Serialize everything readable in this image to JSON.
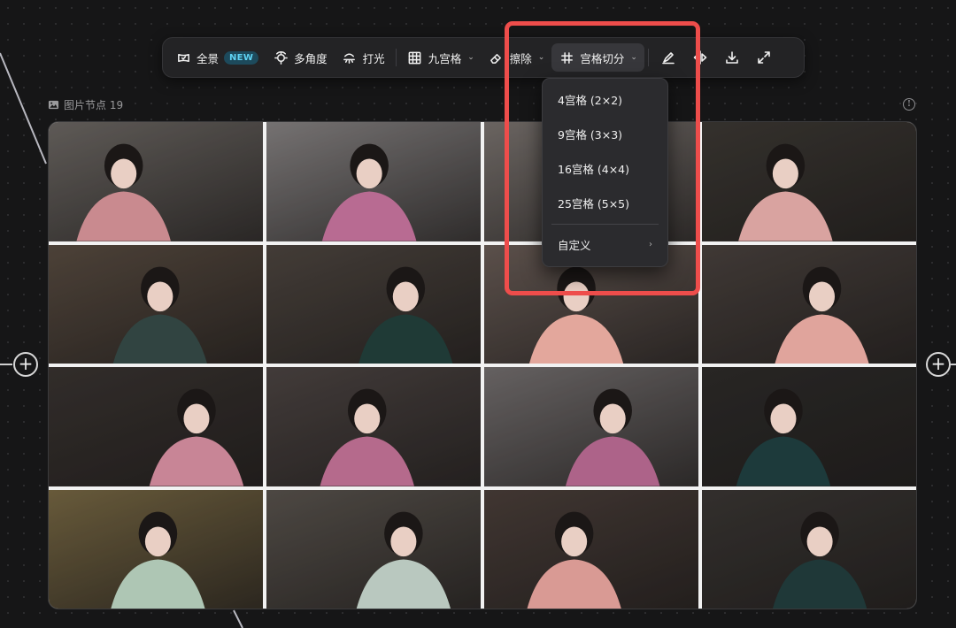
{
  "toolbar": {
    "panorama_label": "全景",
    "panorama_badge": "NEW",
    "multi_angle_label": "多角度",
    "lighting_label": "打光",
    "nine_grid_label": "九宫格",
    "erase_label": "擦除",
    "grid_split_label": "宫格切分",
    "icons": [
      "panorama-icon",
      "multi-angle-icon",
      "lighting-icon",
      "grid-icon",
      "eraser-icon",
      "grid-split-icon",
      "brush-icon",
      "flip-icon",
      "download-icon",
      "fullscreen-icon"
    ]
  },
  "node": {
    "title": "图片节点 19"
  },
  "grid_split_menu": {
    "options": [
      {
        "label": "4宫格 (2×2)"
      },
      {
        "label": "9宫格 (3×3)"
      },
      {
        "label": "16宫格 (4×4)"
      },
      {
        "label": "25宫格 (5×5)"
      }
    ],
    "custom_label": "自定义"
  },
  "image_grid": {
    "rows": 4,
    "columns": 4,
    "cells": [
      {
        "bg": "#6f6a66",
        "accent": "#c98a8f"
      },
      {
        "bg": "#8a8686",
        "accent": "#b86b92"
      },
      {
        "bg": "#7d7672",
        "accent": "#c77f93"
      },
      {
        "bg": "#3e3a35",
        "accent": "#d9a3a0"
      },
      {
        "bg": "#5a4d42",
        "accent": "#314441"
      },
      {
        "bg": "#4f4741",
        "accent": "#1f3a36"
      },
      {
        "bg": "#6b5e58",
        "accent": "#e3a79c"
      },
      {
        "bg": "#4b433f",
        "accent": "#e0a49c"
      },
      {
        "bg": "#3b3532",
        "accent": "#c88596"
      },
      {
        "bg": "#4e4644",
        "accent": "#b56a8c"
      },
      {
        "bg": "#777272",
        "accent": "#ad6389"
      },
      {
        "bg": "#2f2d2b",
        "accent": "#1d3a3b"
      },
      {
        "bg": "#7a6a45",
        "accent": "#aec6b4"
      },
      {
        "bg": "#5b554f",
        "accent": "#b9c8bf"
      },
      {
        "bg": "#4c403b",
        "accent": "#d99a94"
      },
      {
        "bg": "#3c3835",
        "accent": "#1f3838"
      }
    ]
  },
  "colors": {
    "highlight": "#ee4d4b",
    "new_badge_text": "#5fd3f3"
  }
}
